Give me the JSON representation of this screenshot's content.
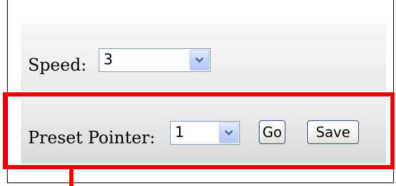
{
  "speed": {
    "label": "Speed:",
    "selected_value": "3",
    "arrow_icon": "chevron-down-icon"
  },
  "preset": {
    "label": "Preset Pointer:",
    "selected_value": "1",
    "go_label": "Go",
    "save_label": "Save"
  },
  "colors": {
    "highlight": "#ee0000",
    "select_border": "#7f9db9",
    "button_border": "#2c4f85"
  }
}
